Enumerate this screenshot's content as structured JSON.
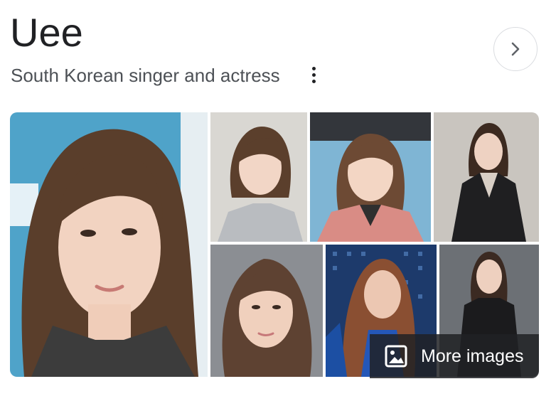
{
  "entity": {
    "title": "Uee",
    "subtitle": "South Korean singer and actress"
  },
  "icons": {
    "more_options": "three-dots-vertical-icon",
    "next": "chevron-right-icon",
    "images": "image-icon"
  },
  "gallery": {
    "more_images_label": "More images",
    "photos": [
      {
        "name": "main-portrait-photo",
        "background": "#4fa3c9"
      },
      {
        "name": "photo-2-grey-top",
        "background": "#d9d7d2"
      },
      {
        "name": "photo-3-pink-blazer",
        "background": "#7fb5d4"
      },
      {
        "name": "photo-4-black-jacket",
        "background": "#c9c5bf"
      },
      {
        "name": "photo-5-grey-backdrop",
        "background": "#8b8e93"
      },
      {
        "name": "photo-6-stage-blue-dress",
        "background": "#1d3a6b"
      },
      {
        "name": "photo-7-black-outfit",
        "background": "#6c7075"
      }
    ]
  },
  "colors": {
    "title_text": "#202124",
    "subtitle_text": "#4d5156",
    "overlay": "#202124"
  }
}
